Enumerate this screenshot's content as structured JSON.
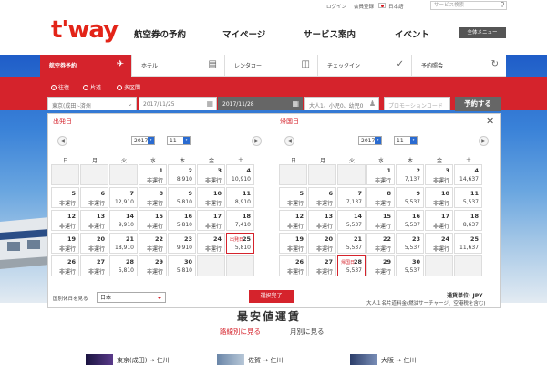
{
  "header": {
    "utility": {
      "login": "ログイン",
      "register": "会員登録",
      "language": "日本語",
      "search_placeholder": "サービス検索"
    },
    "logo": "t'way",
    "nav": [
      "航空券の予約",
      "マイページ",
      "サービス案内",
      "イベント"
    ],
    "all_menu": "全体メニュー"
  },
  "tabs": [
    {
      "label": "航空券予約",
      "icon": "airplane-icon"
    },
    {
      "label": "ホテル",
      "icon": "bed-icon"
    },
    {
      "label": "レンタカー",
      "icon": "car-icon"
    },
    {
      "label": "チェックイン",
      "icon": "checkmark-icon"
    },
    {
      "label": "予約照会",
      "icon": "refresh-icon"
    }
  ],
  "trip_types": [
    "往復",
    "片道",
    "多区間"
  ],
  "search": {
    "route": "東京(成田)-済州",
    "depart_date": "2017/11/25",
    "return_date": "2017/11/28",
    "passengers": "大人1、小児0、幼児0",
    "promo_placeholder": "プロモーションコード",
    "submit": "予約する"
  },
  "calendar": {
    "weekdays": [
      "日",
      "月",
      "火",
      "水",
      "木",
      "金",
      "土"
    ],
    "departure": {
      "title": "出発日",
      "year": "2017",
      "month": "11",
      "weeks": [
        [
          null,
          null,
          null,
          {
            "d": "1",
            "p": "非運行"
          },
          {
            "d": "2",
            "p": "8,910"
          },
          {
            "d": "3",
            "p": "非運行"
          },
          {
            "d": "4",
            "p": "10,910"
          }
        ],
        [
          {
            "d": "5",
            "p": "非運行"
          },
          {
            "d": "6",
            "p": "非運行"
          },
          {
            "d": "7",
            "p": "12,910"
          },
          {
            "d": "8",
            "p": "非運行"
          },
          {
            "d": "9",
            "p": "5,810"
          },
          {
            "d": "10",
            "p": "非運行"
          },
          {
            "d": "11",
            "p": "8,910"
          }
        ],
        [
          {
            "d": "12",
            "p": "非運行"
          },
          {
            "d": "13",
            "p": "非運行"
          },
          {
            "d": "14",
            "p": "9,910"
          },
          {
            "d": "15",
            "p": "非運行"
          },
          {
            "d": "16",
            "p": "5,810"
          },
          {
            "d": "17",
            "p": "非運行"
          },
          {
            "d": "18",
            "p": "7,410"
          }
        ],
        [
          {
            "d": "19",
            "p": "非運行"
          },
          {
            "d": "20",
            "p": "非運行"
          },
          {
            "d": "21",
            "p": "18,910"
          },
          {
            "d": "22",
            "p": "非運行"
          },
          {
            "d": "23",
            "p": "9,910"
          },
          {
            "d": "24",
            "p": "非運行"
          },
          {
            "d": "25",
            "p": "5,810",
            "tag": "出発日"
          }
        ],
        [
          {
            "d": "26",
            "p": "非運行"
          },
          {
            "d": "27",
            "p": "非運行"
          },
          {
            "d": "28",
            "p": "5,810"
          },
          {
            "d": "29",
            "p": "非運行"
          },
          {
            "d": "30",
            "p": "5,810"
          },
          null,
          null
        ]
      ]
    },
    "return": {
      "title": "帰国日",
      "year": "2017",
      "month": "11",
      "weeks": [
        [
          null,
          null,
          null,
          {
            "d": "1",
            "p": "非運行"
          },
          {
            "d": "2",
            "p": "7,137"
          },
          {
            "d": "3",
            "p": "非運行"
          },
          {
            "d": "4",
            "p": "14,637"
          }
        ],
        [
          {
            "d": "5",
            "p": "非運行"
          },
          {
            "d": "6",
            "p": "非運行"
          },
          {
            "d": "7",
            "p": "7,137"
          },
          {
            "d": "8",
            "p": "非運行"
          },
          {
            "d": "9",
            "p": "5,537"
          },
          {
            "d": "10",
            "p": "非運行"
          },
          {
            "d": "11",
            "p": "5,537"
          }
        ],
        [
          {
            "d": "12",
            "p": "非運行"
          },
          {
            "d": "13",
            "p": "非運行"
          },
          {
            "d": "14",
            "p": "5,537"
          },
          {
            "d": "15",
            "p": "非運行"
          },
          {
            "d": "16",
            "p": "5,537"
          },
          {
            "d": "17",
            "p": "非運行"
          },
          {
            "d": "18",
            "p": "8,637"
          }
        ],
        [
          {
            "d": "19",
            "p": "非運行"
          },
          {
            "d": "20",
            "p": "非運行"
          },
          {
            "d": "21",
            "p": "5,537"
          },
          {
            "d": "22",
            "p": "非運行"
          },
          {
            "d": "23",
            "p": "5,537"
          },
          {
            "d": "24",
            "p": "非運行"
          },
          {
            "d": "25",
            "p": "11,637"
          }
        ],
        [
          {
            "d": "26",
            "p": "非運行"
          },
          {
            "d": "27",
            "p": "非運行"
          },
          {
            "d": "28",
            "p": "5,537",
            "tag": "帰国日"
          },
          {
            "d": "29",
            "p": "非運行"
          },
          {
            "d": "30",
            "p": "5,537"
          },
          null,
          null
        ]
      ]
    },
    "holiday_label": "国別休日を見る",
    "holiday_country": "日本",
    "done": "選択完了",
    "currency_label": "通貨単位: JPY",
    "fare_note": "大人１名片道料金(燃油サーチャージ、空港税を含む)"
  },
  "section": {
    "title": "最安値運賃",
    "subtabs": [
      "路線別に見る",
      "月別に見る"
    ],
    "cards": [
      "東京(成田) → 仁川",
      "佐賀 → 仁川",
      "大阪 → 仁川"
    ]
  },
  "colors": {
    "brand_red": "#d5232c",
    "logo_red": "#e32418",
    "dark_button": "#666666"
  }
}
